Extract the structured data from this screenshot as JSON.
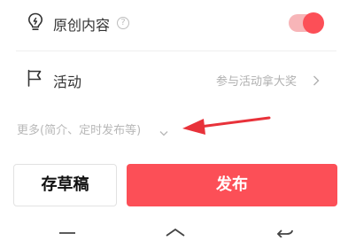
{
  "original_content": {
    "label": "原创内容",
    "toggle_on": true,
    "toggle_color": "#fc4f57",
    "icon": "lightbulb-icon",
    "help_icon_glyph": "?"
  },
  "activity": {
    "label": "活动",
    "hint": "参与活动拿大奖",
    "icon": "flag-icon"
  },
  "more_options": {
    "label": "更多(简介、定时发布等)",
    "icon": "chevron-down-icon"
  },
  "annotation": {
    "icon": "red-arrow-icon",
    "color": "#e8323a"
  },
  "buttons": {
    "draft_label": "存草稿",
    "publish_label": "发布",
    "publish_color": "#fc4f57"
  },
  "system_nav": {
    "icons": [
      "menu-icon",
      "home-icon",
      "back-icon"
    ]
  }
}
